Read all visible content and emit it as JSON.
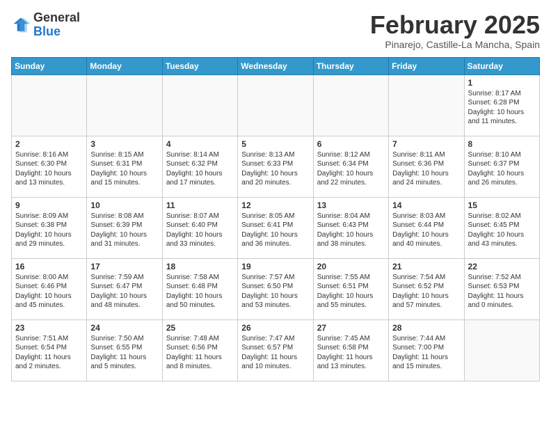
{
  "header": {
    "logo": {
      "general": "General",
      "blue": "Blue"
    },
    "title": "February 2025",
    "subtitle": "Pinarejo, Castille-La Mancha, Spain"
  },
  "calendar": {
    "days_of_week": [
      "Sunday",
      "Monday",
      "Tuesday",
      "Wednesday",
      "Thursday",
      "Friday",
      "Saturday"
    ],
    "weeks": [
      [
        {
          "num": "",
          "info": ""
        },
        {
          "num": "",
          "info": ""
        },
        {
          "num": "",
          "info": ""
        },
        {
          "num": "",
          "info": ""
        },
        {
          "num": "",
          "info": ""
        },
        {
          "num": "",
          "info": ""
        },
        {
          "num": "1",
          "info": "Sunrise: 8:17 AM\nSunset: 6:28 PM\nDaylight: 10 hours\nand 11 minutes."
        }
      ],
      [
        {
          "num": "2",
          "info": "Sunrise: 8:16 AM\nSunset: 6:30 PM\nDaylight: 10 hours\nand 13 minutes."
        },
        {
          "num": "3",
          "info": "Sunrise: 8:15 AM\nSunset: 6:31 PM\nDaylight: 10 hours\nand 15 minutes."
        },
        {
          "num": "4",
          "info": "Sunrise: 8:14 AM\nSunset: 6:32 PM\nDaylight: 10 hours\nand 17 minutes."
        },
        {
          "num": "5",
          "info": "Sunrise: 8:13 AM\nSunset: 6:33 PM\nDaylight: 10 hours\nand 20 minutes."
        },
        {
          "num": "6",
          "info": "Sunrise: 8:12 AM\nSunset: 6:34 PM\nDaylight: 10 hours\nand 22 minutes."
        },
        {
          "num": "7",
          "info": "Sunrise: 8:11 AM\nSunset: 6:36 PM\nDaylight: 10 hours\nand 24 minutes."
        },
        {
          "num": "8",
          "info": "Sunrise: 8:10 AM\nSunset: 6:37 PM\nDaylight: 10 hours\nand 26 minutes."
        }
      ],
      [
        {
          "num": "9",
          "info": "Sunrise: 8:09 AM\nSunset: 6:38 PM\nDaylight: 10 hours\nand 29 minutes."
        },
        {
          "num": "10",
          "info": "Sunrise: 8:08 AM\nSunset: 6:39 PM\nDaylight: 10 hours\nand 31 minutes."
        },
        {
          "num": "11",
          "info": "Sunrise: 8:07 AM\nSunset: 6:40 PM\nDaylight: 10 hours\nand 33 minutes."
        },
        {
          "num": "12",
          "info": "Sunrise: 8:05 AM\nSunset: 6:41 PM\nDaylight: 10 hours\nand 36 minutes."
        },
        {
          "num": "13",
          "info": "Sunrise: 8:04 AM\nSunset: 6:43 PM\nDaylight: 10 hours\nand 38 minutes."
        },
        {
          "num": "14",
          "info": "Sunrise: 8:03 AM\nSunset: 6:44 PM\nDaylight: 10 hours\nand 40 minutes."
        },
        {
          "num": "15",
          "info": "Sunrise: 8:02 AM\nSunset: 6:45 PM\nDaylight: 10 hours\nand 43 minutes."
        }
      ],
      [
        {
          "num": "16",
          "info": "Sunrise: 8:00 AM\nSunset: 6:46 PM\nDaylight: 10 hours\nand 45 minutes."
        },
        {
          "num": "17",
          "info": "Sunrise: 7:59 AM\nSunset: 6:47 PM\nDaylight: 10 hours\nand 48 minutes."
        },
        {
          "num": "18",
          "info": "Sunrise: 7:58 AM\nSunset: 6:48 PM\nDaylight: 10 hours\nand 50 minutes."
        },
        {
          "num": "19",
          "info": "Sunrise: 7:57 AM\nSunset: 6:50 PM\nDaylight: 10 hours\nand 53 minutes."
        },
        {
          "num": "20",
          "info": "Sunrise: 7:55 AM\nSunset: 6:51 PM\nDaylight: 10 hours\nand 55 minutes."
        },
        {
          "num": "21",
          "info": "Sunrise: 7:54 AM\nSunset: 6:52 PM\nDaylight: 10 hours\nand 57 minutes."
        },
        {
          "num": "22",
          "info": "Sunrise: 7:52 AM\nSunset: 6:53 PM\nDaylight: 11 hours\nand 0 minutes."
        }
      ],
      [
        {
          "num": "23",
          "info": "Sunrise: 7:51 AM\nSunset: 6:54 PM\nDaylight: 11 hours\nand 2 minutes."
        },
        {
          "num": "24",
          "info": "Sunrise: 7:50 AM\nSunset: 6:55 PM\nDaylight: 11 hours\nand 5 minutes."
        },
        {
          "num": "25",
          "info": "Sunrise: 7:48 AM\nSunset: 6:56 PM\nDaylight: 11 hours\nand 8 minutes."
        },
        {
          "num": "26",
          "info": "Sunrise: 7:47 AM\nSunset: 6:57 PM\nDaylight: 11 hours\nand 10 minutes."
        },
        {
          "num": "27",
          "info": "Sunrise: 7:45 AM\nSunset: 6:58 PM\nDaylight: 11 hours\nand 13 minutes."
        },
        {
          "num": "28",
          "info": "Sunrise: 7:44 AM\nSunset: 7:00 PM\nDaylight: 11 hours\nand 15 minutes."
        },
        {
          "num": "",
          "info": ""
        }
      ]
    ]
  }
}
